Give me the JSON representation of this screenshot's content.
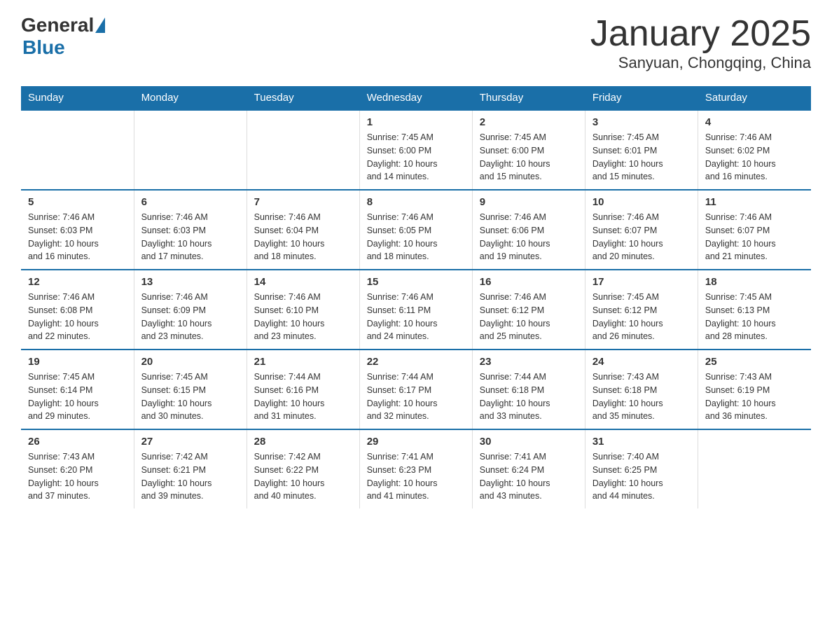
{
  "header": {
    "logo_general": "General",
    "logo_blue": "Blue",
    "month_title": "January 2025",
    "location": "Sanyuan, Chongqing, China"
  },
  "days_of_week": [
    "Sunday",
    "Monday",
    "Tuesday",
    "Wednesday",
    "Thursday",
    "Friday",
    "Saturday"
  ],
  "weeks": [
    [
      {
        "day": "",
        "info": ""
      },
      {
        "day": "",
        "info": ""
      },
      {
        "day": "",
        "info": ""
      },
      {
        "day": "1",
        "info": "Sunrise: 7:45 AM\nSunset: 6:00 PM\nDaylight: 10 hours\nand 14 minutes."
      },
      {
        "day": "2",
        "info": "Sunrise: 7:45 AM\nSunset: 6:00 PM\nDaylight: 10 hours\nand 15 minutes."
      },
      {
        "day": "3",
        "info": "Sunrise: 7:45 AM\nSunset: 6:01 PM\nDaylight: 10 hours\nand 15 minutes."
      },
      {
        "day": "4",
        "info": "Sunrise: 7:46 AM\nSunset: 6:02 PM\nDaylight: 10 hours\nand 16 minutes."
      }
    ],
    [
      {
        "day": "5",
        "info": "Sunrise: 7:46 AM\nSunset: 6:03 PM\nDaylight: 10 hours\nand 16 minutes."
      },
      {
        "day": "6",
        "info": "Sunrise: 7:46 AM\nSunset: 6:03 PM\nDaylight: 10 hours\nand 17 minutes."
      },
      {
        "day": "7",
        "info": "Sunrise: 7:46 AM\nSunset: 6:04 PM\nDaylight: 10 hours\nand 18 minutes."
      },
      {
        "day": "8",
        "info": "Sunrise: 7:46 AM\nSunset: 6:05 PM\nDaylight: 10 hours\nand 18 minutes."
      },
      {
        "day": "9",
        "info": "Sunrise: 7:46 AM\nSunset: 6:06 PM\nDaylight: 10 hours\nand 19 minutes."
      },
      {
        "day": "10",
        "info": "Sunrise: 7:46 AM\nSunset: 6:07 PM\nDaylight: 10 hours\nand 20 minutes."
      },
      {
        "day": "11",
        "info": "Sunrise: 7:46 AM\nSunset: 6:07 PM\nDaylight: 10 hours\nand 21 minutes."
      }
    ],
    [
      {
        "day": "12",
        "info": "Sunrise: 7:46 AM\nSunset: 6:08 PM\nDaylight: 10 hours\nand 22 minutes."
      },
      {
        "day": "13",
        "info": "Sunrise: 7:46 AM\nSunset: 6:09 PM\nDaylight: 10 hours\nand 23 minutes."
      },
      {
        "day": "14",
        "info": "Sunrise: 7:46 AM\nSunset: 6:10 PM\nDaylight: 10 hours\nand 23 minutes."
      },
      {
        "day": "15",
        "info": "Sunrise: 7:46 AM\nSunset: 6:11 PM\nDaylight: 10 hours\nand 24 minutes."
      },
      {
        "day": "16",
        "info": "Sunrise: 7:46 AM\nSunset: 6:12 PM\nDaylight: 10 hours\nand 25 minutes."
      },
      {
        "day": "17",
        "info": "Sunrise: 7:45 AM\nSunset: 6:12 PM\nDaylight: 10 hours\nand 26 minutes."
      },
      {
        "day": "18",
        "info": "Sunrise: 7:45 AM\nSunset: 6:13 PM\nDaylight: 10 hours\nand 28 minutes."
      }
    ],
    [
      {
        "day": "19",
        "info": "Sunrise: 7:45 AM\nSunset: 6:14 PM\nDaylight: 10 hours\nand 29 minutes."
      },
      {
        "day": "20",
        "info": "Sunrise: 7:45 AM\nSunset: 6:15 PM\nDaylight: 10 hours\nand 30 minutes."
      },
      {
        "day": "21",
        "info": "Sunrise: 7:44 AM\nSunset: 6:16 PM\nDaylight: 10 hours\nand 31 minutes."
      },
      {
        "day": "22",
        "info": "Sunrise: 7:44 AM\nSunset: 6:17 PM\nDaylight: 10 hours\nand 32 minutes."
      },
      {
        "day": "23",
        "info": "Sunrise: 7:44 AM\nSunset: 6:18 PM\nDaylight: 10 hours\nand 33 minutes."
      },
      {
        "day": "24",
        "info": "Sunrise: 7:43 AM\nSunset: 6:18 PM\nDaylight: 10 hours\nand 35 minutes."
      },
      {
        "day": "25",
        "info": "Sunrise: 7:43 AM\nSunset: 6:19 PM\nDaylight: 10 hours\nand 36 minutes."
      }
    ],
    [
      {
        "day": "26",
        "info": "Sunrise: 7:43 AM\nSunset: 6:20 PM\nDaylight: 10 hours\nand 37 minutes."
      },
      {
        "day": "27",
        "info": "Sunrise: 7:42 AM\nSunset: 6:21 PM\nDaylight: 10 hours\nand 39 minutes."
      },
      {
        "day": "28",
        "info": "Sunrise: 7:42 AM\nSunset: 6:22 PM\nDaylight: 10 hours\nand 40 minutes."
      },
      {
        "day": "29",
        "info": "Sunrise: 7:41 AM\nSunset: 6:23 PM\nDaylight: 10 hours\nand 41 minutes."
      },
      {
        "day": "30",
        "info": "Sunrise: 7:41 AM\nSunset: 6:24 PM\nDaylight: 10 hours\nand 43 minutes."
      },
      {
        "day": "31",
        "info": "Sunrise: 7:40 AM\nSunset: 6:25 PM\nDaylight: 10 hours\nand 44 minutes."
      },
      {
        "day": "",
        "info": ""
      }
    ]
  ]
}
